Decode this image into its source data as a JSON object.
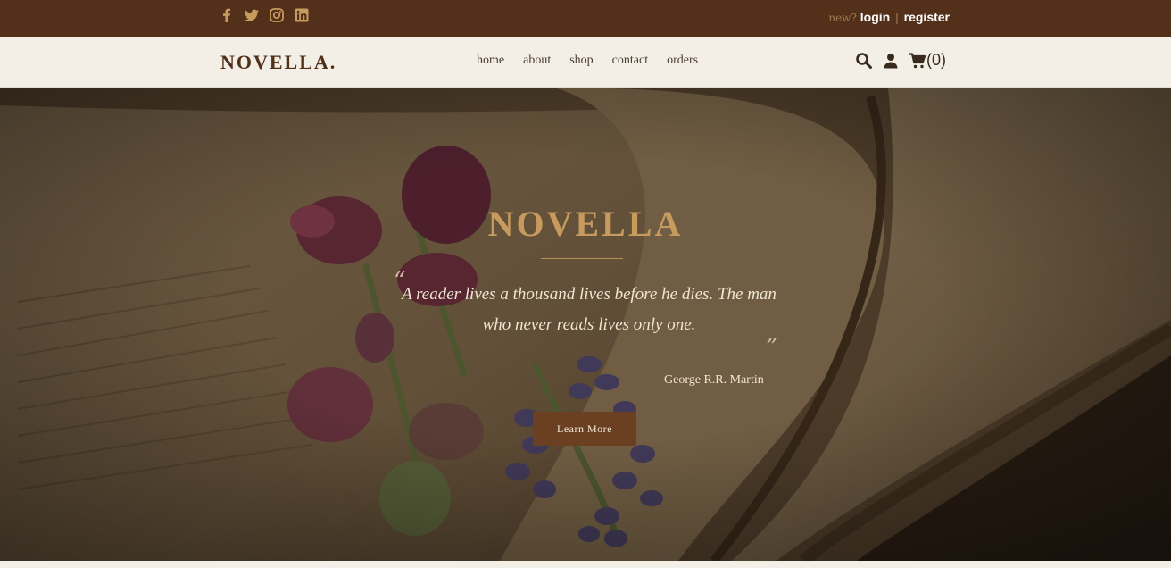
{
  "topbar": {
    "social": [
      "facebook-icon",
      "twitter-icon",
      "instagram-icon",
      "linkedin-icon"
    ],
    "new_label": "new?",
    "login_label": "login",
    "separator": "|",
    "register_label": "register"
  },
  "navbar": {
    "logo": "NOVELLA.",
    "menu": [
      "home",
      "about",
      "shop",
      "contact",
      "orders"
    ],
    "cart_count": "(0)"
  },
  "hero": {
    "title": "NOVELLA",
    "quote_open": "“",
    "quote": "A reader lives a thousand lives before he dies. The man who never reads lives only one.",
    "quote_close": "”",
    "author": "George R.R. Martin",
    "button_label": "Learn More"
  },
  "colors": {
    "topbar": "#52301a",
    "accent_gold": "#c79a5e",
    "button": "#6a3f22",
    "nav_bg": "#f3efe6"
  }
}
